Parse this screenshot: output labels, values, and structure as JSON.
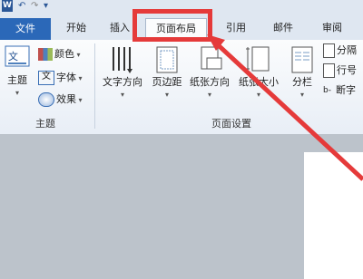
{
  "qat": {
    "app_icon": "W"
  },
  "tabs": [
    {
      "label": "文件"
    },
    {
      "label": "开始"
    },
    {
      "label": "插入"
    },
    {
      "label": "页面布局"
    },
    {
      "label": "引用"
    },
    {
      "label": "邮件"
    },
    {
      "label": "审阅"
    }
  ],
  "ribbon": {
    "theme_group": {
      "themes_label": "主题",
      "colors_label": "颜色",
      "fonts_label": "字体",
      "effects_label": "效果",
      "group_label": "主题"
    },
    "page_setup_group": {
      "text_direction_label": "文字方向",
      "margins_label": "页边距",
      "orientation_label": "纸张方向",
      "size_label": "纸张大小",
      "columns_label": "分栏",
      "breaks_label": "分隔",
      "line_numbers_label": "行号",
      "hyphenation_label": "断字",
      "group_label": "页面设置"
    }
  },
  "annotation": {
    "highlight_color": "#e53a3a"
  }
}
